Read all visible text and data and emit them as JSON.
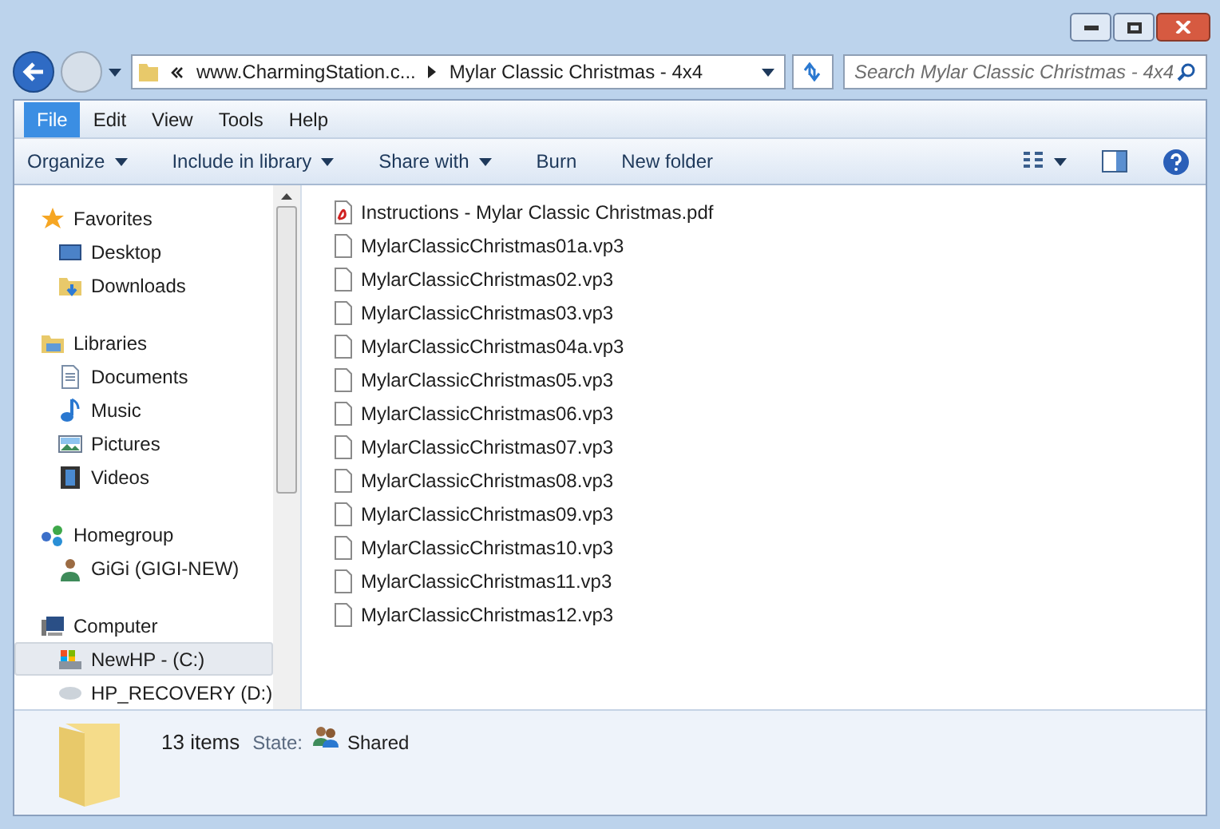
{
  "address": {
    "parent": "www.CharmingStation.c...",
    "current": "Mylar Classic Christmas - 4x4"
  },
  "search": {
    "placeholder": "Search Mylar Classic Christmas - 4x4"
  },
  "menu": [
    {
      "label": "File",
      "selected": true
    },
    {
      "label": "Edit",
      "selected": false
    },
    {
      "label": "View",
      "selected": false
    },
    {
      "label": "Tools",
      "selected": false
    },
    {
      "label": "Help",
      "selected": false
    }
  ],
  "toolbar": [
    {
      "label": "Organize",
      "dropdown": true
    },
    {
      "label": "Include in library",
      "dropdown": true
    },
    {
      "label": "Share with",
      "dropdown": true
    },
    {
      "label": "Burn",
      "dropdown": false
    },
    {
      "label": "New folder",
      "dropdown": false
    }
  ],
  "sidebar": [
    {
      "label": "Favorites",
      "children": [
        {
          "label": "Desktop",
          "selected": false
        },
        {
          "label": "Downloads",
          "selected": false
        }
      ]
    },
    {
      "label": "Libraries",
      "children": [
        {
          "label": "Documents",
          "selected": false
        },
        {
          "label": "Music",
          "selected": false
        },
        {
          "label": "Pictures",
          "selected": false
        },
        {
          "label": "Videos",
          "selected": false
        }
      ]
    },
    {
      "label": "Homegroup",
      "children": [
        {
          "label": "GiGi (GIGI-NEW)",
          "selected": false
        }
      ]
    },
    {
      "label": "Computer",
      "children": [
        {
          "label": "NewHP - (C:)",
          "selected": true
        },
        {
          "label": "HP_RECOVERY (D:)",
          "selected": false
        }
      ]
    }
  ],
  "files": [
    {
      "name": "Instructions - Mylar Classic Christmas.pdf",
      "kind": "pdf"
    },
    {
      "name": "MylarClassicChristmas01a.vp3",
      "kind": "file"
    },
    {
      "name": "MylarClassicChristmas02.vp3",
      "kind": "file"
    },
    {
      "name": "MylarClassicChristmas03.vp3",
      "kind": "file"
    },
    {
      "name": "MylarClassicChristmas04a.vp3",
      "kind": "file"
    },
    {
      "name": "MylarClassicChristmas05.vp3",
      "kind": "file"
    },
    {
      "name": "MylarClassicChristmas06.vp3",
      "kind": "file"
    },
    {
      "name": "MylarClassicChristmas07.vp3",
      "kind": "file"
    },
    {
      "name": "MylarClassicChristmas08.vp3",
      "kind": "file"
    },
    {
      "name": "MylarClassicChristmas09.vp3",
      "kind": "file"
    },
    {
      "name": "MylarClassicChristmas10.vp3",
      "kind": "file"
    },
    {
      "name": "MylarClassicChristmas11.vp3",
      "kind": "file"
    },
    {
      "name": "MylarClassicChristmas12.vp3",
      "kind": "file"
    }
  ],
  "details": {
    "count": "13 items",
    "state_label": "State:",
    "state": "Shared"
  }
}
